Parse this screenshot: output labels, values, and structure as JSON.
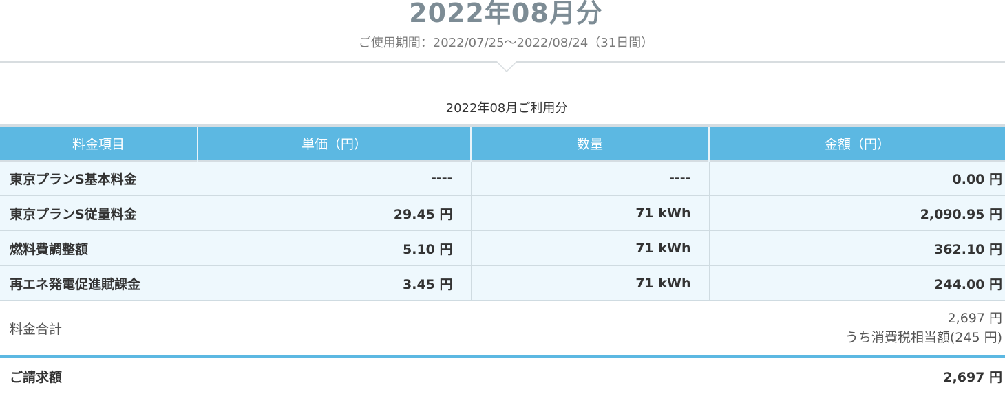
{
  "header": {
    "month_title": "2022年08月分",
    "period": "ご使用期間：2022/07/25～2022/08/24（31日間）"
  },
  "usage_caption": "2022年08月ご利用分",
  "table": {
    "columns": [
      "料金項目",
      "単価（円）",
      "数量",
      "金額（円）"
    ],
    "rows": [
      {
        "item": "東京プランS基本料金",
        "unit_price": "----",
        "quantity": "----",
        "amount": "0.00 円"
      },
      {
        "item": "東京プランS従量料金",
        "unit_price": "29.45 円",
        "quantity": "71 kWh",
        "amount": "2,090.95 円"
      },
      {
        "item": "燃料費調整額",
        "unit_price": "5.10 円",
        "quantity": "71 kWh",
        "amount": "362.10 円"
      },
      {
        "item": "再エネ発電促進賦課金",
        "unit_price": "3.45 円",
        "quantity": "71 kWh",
        "amount": "244.00 円"
      }
    ],
    "total": {
      "label": "料金合計",
      "amount": "2,697 円",
      "tax_note": "うち消費税相当額(245 円)"
    },
    "billing": {
      "label": "ご請求額",
      "amount": "2,697 円"
    }
  },
  "colors": {
    "header_bg": "#5cb8e2",
    "row_bg": "#eef8fd",
    "title_color": "#7d8c95"
  }
}
